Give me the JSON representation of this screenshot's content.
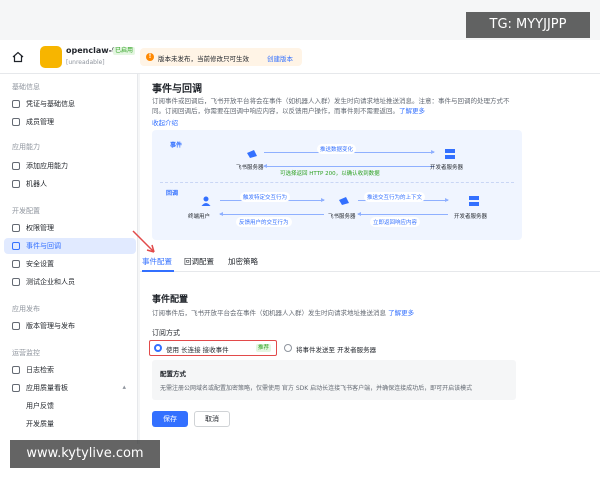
{
  "watermarks": {
    "top": "TG: MYYJJPP",
    "bottom": "www.kytylive.com"
  },
  "colors": {
    "accent": "#3370ff",
    "highlight_box": "#e24a4a",
    "success": "#2ea121",
    "warning": "#ff8800"
  },
  "header": {
    "app_name": "openclaw-test",
    "app_badge": "已启用",
    "app_subtitle": "[unreadable]",
    "notice": {
      "icon": "!",
      "text": "版本未发布，当前修改只可生效",
      "link": "创建版本"
    }
  },
  "sidebar": {
    "sections": [
      {
        "title": "基础信息",
        "items": [
          {
            "label": "凭证与基础信息",
            "icon": "key-icon"
          },
          {
            "label": "成员管理",
            "icon": "user-icon"
          }
        ]
      },
      {
        "title": "应用能力",
        "items": [
          {
            "label": "添加应用能力",
            "icon": "grid-icon"
          },
          {
            "label": "机器人",
            "icon": "bot-icon"
          }
        ]
      },
      {
        "title": "开发配置",
        "items": [
          {
            "label": "权限管理",
            "icon": "lock-icon"
          },
          {
            "label": "事件与回调",
            "icon": "event-icon",
            "active": true
          },
          {
            "label": "安全设置",
            "icon": "shield-icon"
          },
          {
            "label": "测试企业和人员",
            "icon": "test-icon"
          }
        ]
      },
      {
        "title": "应用发布",
        "items": [
          {
            "label": "版本管理与发布",
            "icon": "release-icon"
          }
        ]
      },
      {
        "title": "运营监控",
        "items": [
          {
            "label": "日志检索",
            "icon": "log-icon"
          },
          {
            "label": "应用质量看板",
            "icon": "chart-icon",
            "expandable": true
          }
        ],
        "subitems": [
          "用户反馈",
          "开发质量"
        ]
      }
    ]
  },
  "main": {
    "title": "事件与回调",
    "desc_line1": "订阅事件或回调后，飞书开放平台将会在事件（如机器人入群）发生时向请求地址推送消息。注意：事件与回调的处理方式不",
    "desc_line2": "同。订阅回调后，你需要在回调中响应内容，以反馈用户操作，而事件则不需要返回。",
    "desc_link": "了解更多",
    "collapse_link": "收起介绍",
    "diagram": {
      "event_label": "事件",
      "callback_label": "回调",
      "event_pill": "推送数据变化",
      "event_note": "可选择返回 HTTP 200，以确认收到数据",
      "feishu_server": "飞书服务器",
      "dev_server": "开发者服务器",
      "end_user": "终端用户",
      "cb_trigger": "触发特定交互行为",
      "cb_feedback": "反馈用户的交互行为",
      "cb_push": "推送交互行为的上下文",
      "cb_return": "立即返回响应内容"
    },
    "tabs": [
      "事件配置",
      "回调配置",
      "加密策略"
    ],
    "config": {
      "title": "事件配置",
      "desc": "订阅事件后，飞书开放平台会在事件（如机器人入群）发生时向请求地址推送消息",
      "desc_link": "了解更多",
      "subscribe_label": "订阅方式",
      "option1": "使用 长连接 接收事件",
      "option1_badge": "推荐",
      "option2": "将事件发送至 开发者服务器",
      "mode_title": "配置方式",
      "mode_desc": "无需注册公网域名或配置加密策略，仅需使用 官方 SDK 启动长连接飞书客户端，并确保连接成功后，即可开启该模式",
      "save": "保存",
      "cancel": "取消"
    }
  }
}
